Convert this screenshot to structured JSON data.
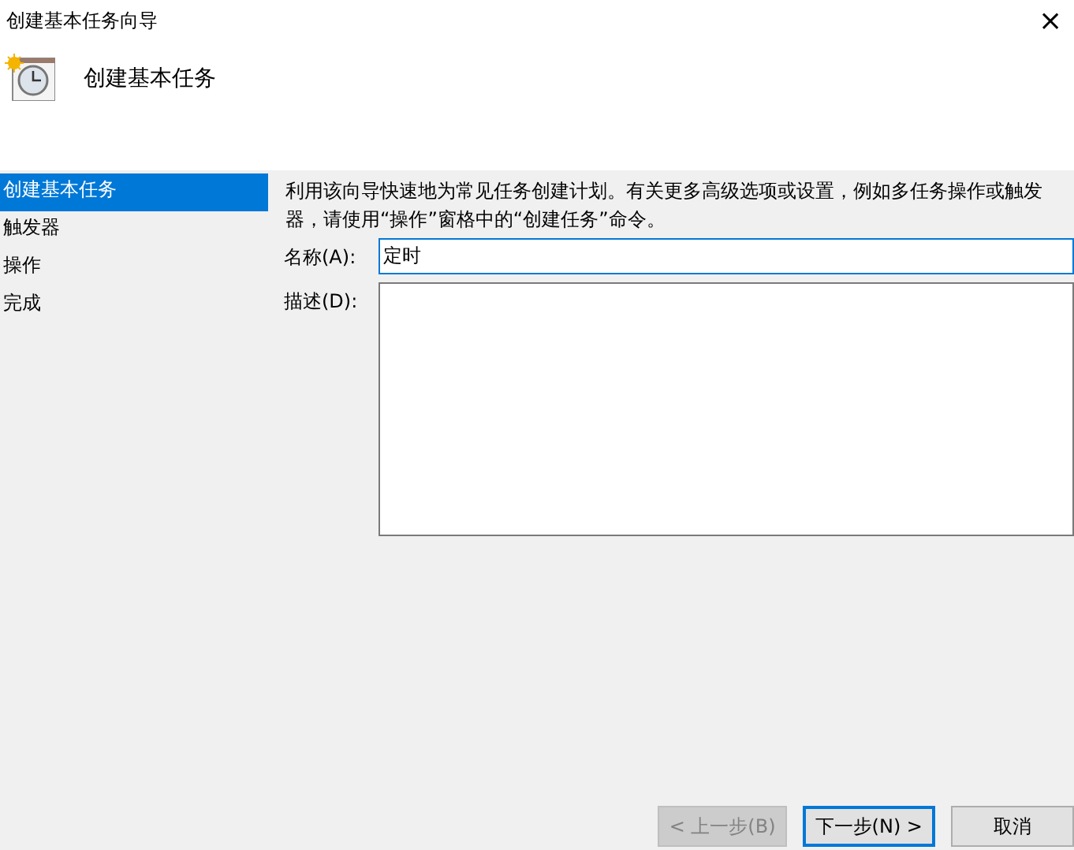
{
  "window": {
    "title": "创建基本任务向导",
    "close": "×"
  },
  "header": {
    "title": "创建基本任务"
  },
  "sidebar": {
    "items": [
      {
        "label": "创建基本任务",
        "selected": true
      },
      {
        "label": "触发器",
        "selected": false
      },
      {
        "label": "操作",
        "selected": false
      },
      {
        "label": "完成",
        "selected": false
      }
    ]
  },
  "intro": "利用该向导快速地为常见任务创建计划。有关更多高级选项或设置，例如多任务操作或触发器，请使用“操作”窗格中的“创建任务”命令。",
  "name_field": {
    "label": "名称(A):",
    "value": "定时"
  },
  "description_field": {
    "label": "描述(D):"
  },
  "buttons": [
    {
      "label": "< 上一步(B)",
      "disabled": true,
      "focused": false
    },
    {
      "label": "下一步(N) >",
      "disabled": false,
      "focused": true
    },
    {
      "label": "取消",
      "disabled": false,
      "focused": false
    }
  ]
}
